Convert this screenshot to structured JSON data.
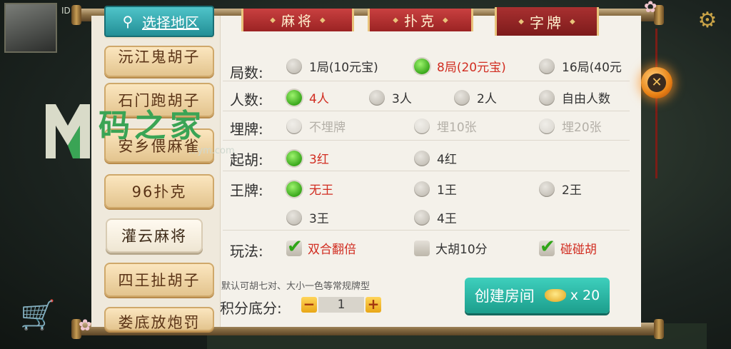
{
  "background": {
    "id_prefix": "ID:",
    "gear_icon": "gear-icon",
    "cart_icon": "cart-icon"
  },
  "watermark": {
    "title": "码之家",
    "url": "...ym.com"
  },
  "location_tab": {
    "label": "选择地区",
    "icon": "location-pin-icon"
  },
  "tabs": [
    {
      "label": "麻将"
    },
    {
      "label": "扑克"
    },
    {
      "label": "字牌",
      "selected": true
    }
  ],
  "games": [
    {
      "label": "沅江鬼胡子"
    },
    {
      "label": "石门跑胡子"
    },
    {
      "label": "安乡偎麻雀"
    },
    {
      "label": "96扑克"
    },
    {
      "label": "灌云麻将",
      "selected": true
    },
    {
      "label": "四王扯胡子"
    },
    {
      "label": "娄底放炮罚"
    }
  ],
  "settings": {
    "rounds": {
      "label": "局数:",
      "options": [
        "1局(10元宝)",
        "8局(20元宝)",
        "16局(40元"
      ],
      "selected": 1
    },
    "players": {
      "label": "人数:",
      "options": [
        "4人",
        "3人",
        "2人",
        "自由人数"
      ],
      "selected": 0
    },
    "bury": {
      "label": "埋牌:",
      "options": [
        "不埋牌",
        "埋10张",
        "埋20张"
      ],
      "disabled": true
    },
    "hu_start": {
      "label": "起胡:",
      "options": [
        "3红",
        "4红"
      ],
      "selected": 0
    },
    "king": {
      "label": "王牌:",
      "options": [
        "无王",
        "1王",
        "2王",
        "3王",
        "4王"
      ],
      "selected": 0
    },
    "play": {
      "label": "玩法:",
      "options": [
        "双合翻倍",
        "大胡10分",
        "碰碰胡"
      ],
      "checked": [
        true,
        false,
        true
      ]
    }
  },
  "hint": "默认可胡七对、大小一色等常规牌型",
  "score": {
    "label": "积分底分:",
    "value": "1",
    "minus": "−",
    "plus": "+"
  },
  "create": {
    "label": "创建房间",
    "cost": "x 20"
  },
  "close": {
    "symbol": "✕"
  },
  "colors": {
    "accent_red": "#d12d21",
    "create_button": "#2bb7a4",
    "tab_red": "#b02c2c"
  }
}
